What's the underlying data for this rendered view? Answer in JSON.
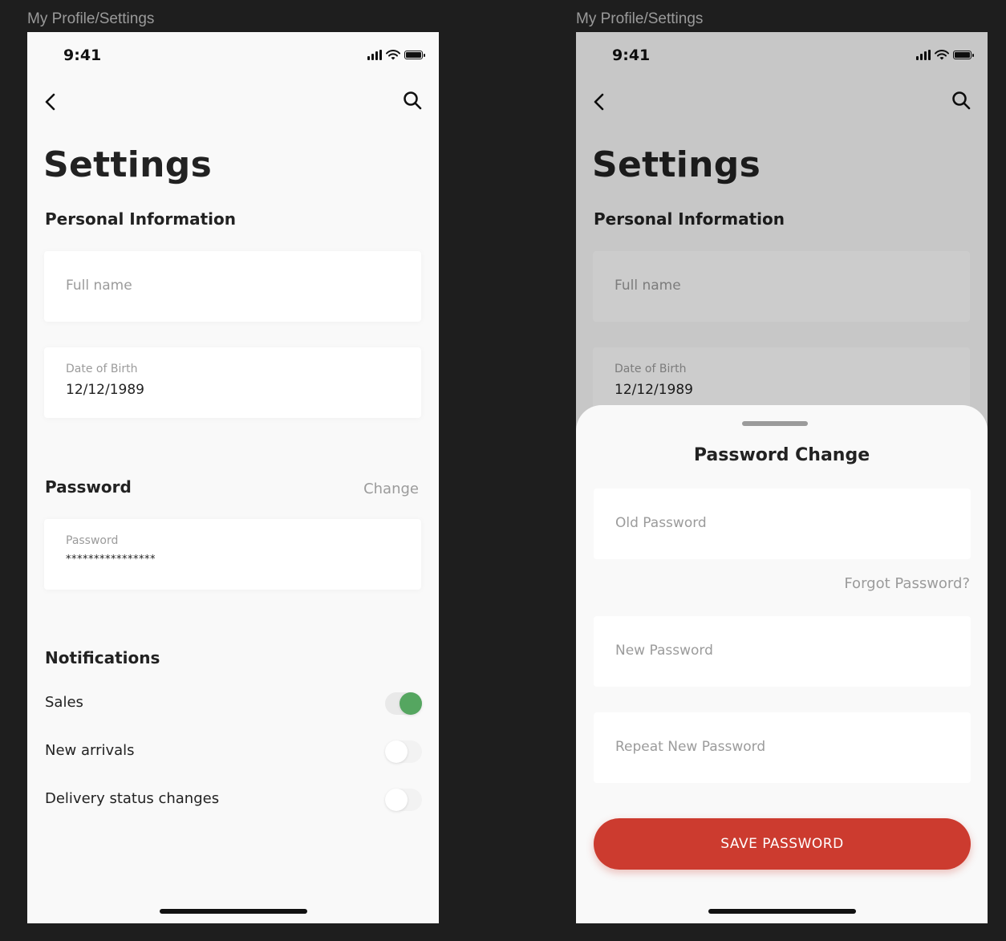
{
  "frames": [
    {
      "label": "My Profile/Settings"
    },
    {
      "label": "My Profile/Settings"
    }
  ],
  "status_bar": {
    "time": "9:41"
  },
  "settings": {
    "title": "Settings",
    "personal_heading": "Personal Information",
    "full_name_placeholder": "Full name",
    "dob_label": "Date of Birth",
    "dob_value": "12/12/1989",
    "password_heading": "Password",
    "change_link": "Change",
    "password_label": "Password",
    "password_value": "****************",
    "notifications_heading": "Notifications",
    "notifications": [
      {
        "label": "Sales",
        "enabled": true
      },
      {
        "label": "New arrivals",
        "enabled": false
      },
      {
        "label": "Delivery status changes",
        "enabled": false
      }
    ]
  },
  "password_sheet": {
    "title": "Password Change",
    "old_password_placeholder": "Old Password",
    "forgot_link": "Forgot Password?",
    "new_password_placeholder": "New Password",
    "repeat_password_placeholder": "Repeat New Password",
    "save_button": "SAVE PASSWORD"
  },
  "colors": {
    "accent": "#cc3b2f",
    "toggle_on": "#55a660",
    "background": "#1e1e1e",
    "screen": "#f9f9f9"
  }
}
